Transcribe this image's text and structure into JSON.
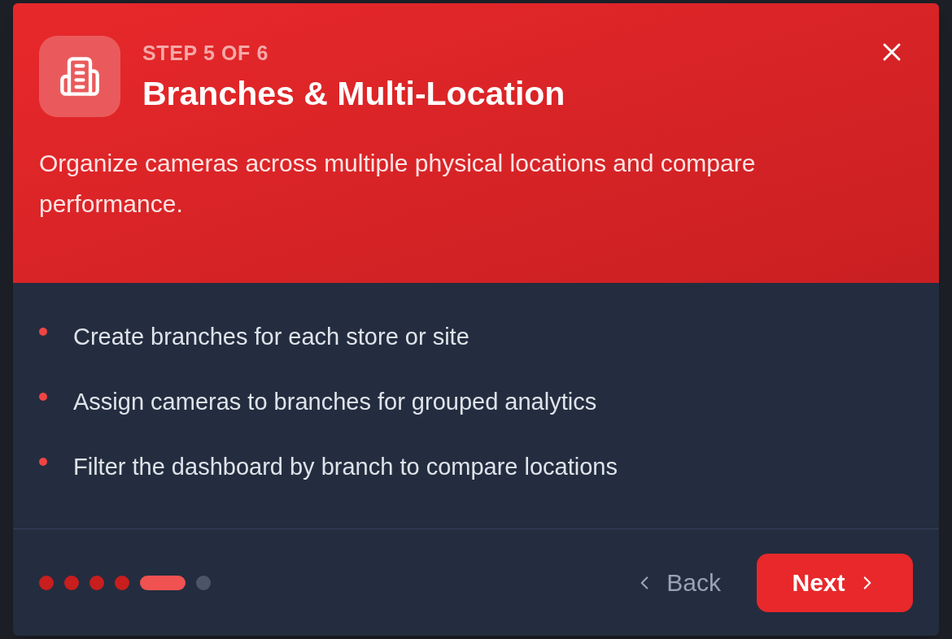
{
  "dialog": {
    "step_label": "STEP 5 OF 6",
    "title": "Branches & Multi-Location",
    "description": "Organize cameras across multiple physical locations and compare performance.",
    "bullets": [
      "Create branches for each store or site",
      "Assign cameras to branches for grouped analytics",
      "Filter the dashboard by branch to compare locations"
    ],
    "steps": [
      {
        "done": true,
        "selected": false
      },
      {
        "done": true,
        "selected": false
      },
      {
        "done": true,
        "selected": false
      },
      {
        "done": true,
        "selected": false
      },
      {
        "done": false,
        "selected": true
      },
      {
        "done": false,
        "selected": false
      }
    ],
    "back_button": "Back",
    "next_button": "Next"
  }
}
